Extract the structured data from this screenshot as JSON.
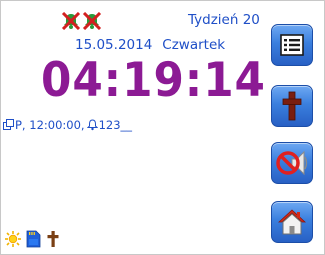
{
  "header": {
    "week_label": "Tydzień 20",
    "date": "15.05.2014",
    "weekday": "Czwartek"
  },
  "clock": {
    "time": "04:19:14"
  },
  "status_line": {
    "prefix_text": "P, 12:00:00, ",
    "counter_text": "123__"
  },
  "alerts": [
    {
      "icon": "muted-bell-icon"
    },
    {
      "icon": "muted-bell-icon"
    }
  ],
  "bottom_icons": [
    "sun-icon",
    "memory-card-icon",
    "cross-icon"
  ],
  "side_buttons": [
    {
      "icon": "list-icon"
    },
    {
      "icon": "cross-icon"
    },
    {
      "icon": "speaker-mute-icon"
    },
    {
      "icon": "home-icon"
    }
  ],
  "colors": {
    "clock": "#8c1a94",
    "text": "#1f4fc7",
    "button": "#3a7fde",
    "alert": "#d32020"
  }
}
